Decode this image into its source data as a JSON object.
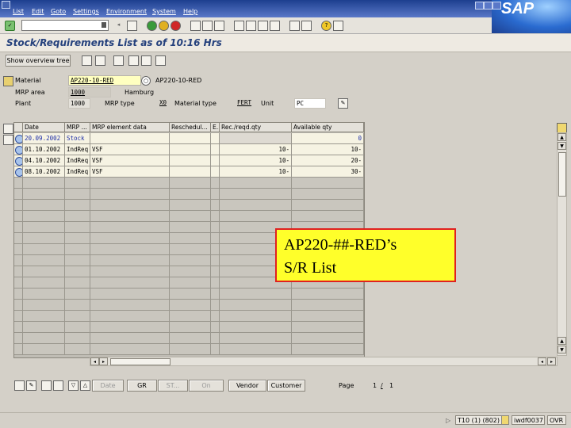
{
  "menu": {
    "items": [
      "List",
      "Edit",
      "Goto",
      "Settings",
      "Environment",
      "System",
      "Help"
    ],
    "brand": "SAP"
  },
  "title": "Stock/Requirements List as of 10:16 Hrs",
  "app_toolbar": {
    "show_overview_tree": "Show overview tree"
  },
  "header": {
    "material_label": "Material",
    "material_value": "AP220-10-RED",
    "material_desc": "AP220-10-RED",
    "mrp_area_label": "MRP area",
    "mrp_area_value": "1000",
    "mrp_area_desc": "Hamburg",
    "plant_label": "Plant",
    "plant_value": "1000",
    "mrp_type_label": "MRP type",
    "mrp_type_value": "X0",
    "material_type_label": "Material type",
    "material_type_value": "FERT",
    "unit_label": "Unit",
    "unit_value": "PC"
  },
  "table": {
    "columns": [
      "Date",
      "MRP ...",
      "MRP element data",
      "Reschedul...",
      "E..",
      "Rec./reqd.qty",
      "Available qty"
    ],
    "rows": [
      {
        "date": "20.09.2002",
        "mrp": "Stock",
        "data": "",
        "resched": "",
        "e": "",
        "qty": "",
        "avail": "0"
      },
      {
        "date": "01.10.2002",
        "mrp": "IndReq",
        "data": "VSF",
        "resched": "",
        "e": "",
        "qty": "10-",
        "avail": "10-"
      },
      {
        "date": "04.10.2002",
        "mrp": "IndReq",
        "data": "VSF",
        "resched": "",
        "e": "",
        "qty": "10-",
        "avail": "20-"
      },
      {
        "date": "08.10.2002",
        "mrp": "IndReq",
        "data": "VSF",
        "resched": "",
        "e": "",
        "qty": "10-",
        "avail": "30-"
      }
    ]
  },
  "bottom_toolbar": {
    "date": "Date",
    "gr": "GR",
    "st": "ST...",
    "on": "On",
    "vendor": "Vendor",
    "customer": "Customer",
    "page_label": "Page",
    "page_current": "1",
    "page_sep": "/",
    "page_total": "1"
  },
  "callout": {
    "line1": "AP220-##-RED’s",
    "line2": "S/R List"
  },
  "status": {
    "system": "T10 (1) (802)",
    "server": "iwdf0037",
    "mode": "OVR"
  },
  "colors": {
    "menu_bar": "#1d3f8f",
    "title_text": "#24407c",
    "callout_fill": "#ffff2a",
    "callout_border": "#e02020"
  }
}
